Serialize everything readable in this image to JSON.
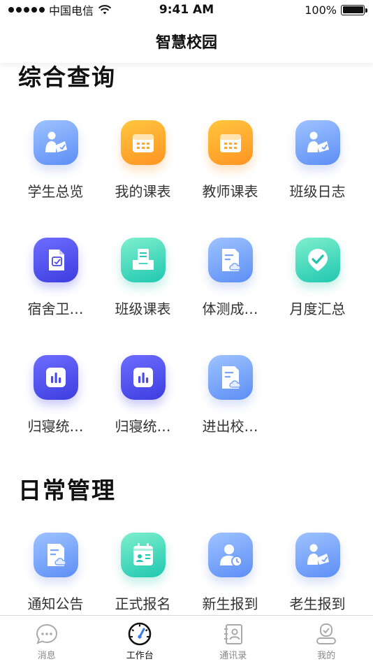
{
  "status_bar": {
    "carrier": "中国电信",
    "time": "9:41 AM",
    "battery": "100%"
  },
  "nav": {
    "title": "智慧校园"
  },
  "sections": [
    {
      "title": "综合查询",
      "items": [
        {
          "label": "学生总览",
          "icon": "student-reading-icon",
          "color": "blue"
        },
        {
          "label": "我的课表",
          "icon": "calendar-icon",
          "color": "orange"
        },
        {
          "label": "教师课表",
          "icon": "calendar-icon",
          "color": "orange"
        },
        {
          "label": "班级日志",
          "icon": "student-reading-icon",
          "color": "blue"
        },
        {
          "label": "宿舍卫…",
          "icon": "document-check-icon",
          "color": "indigo"
        },
        {
          "label": "班级课表",
          "icon": "tray-document-icon",
          "color": "teal"
        },
        {
          "label": "体测成…",
          "icon": "document-cloud-icon",
          "color": "blue"
        },
        {
          "label": "月度汇总",
          "icon": "check-badge-icon",
          "color": "teal"
        },
        {
          "label": "归寝统…",
          "icon": "bar-chart-icon",
          "color": "indigo"
        },
        {
          "label": "归寝统…",
          "icon": "bar-chart-icon",
          "color": "indigo"
        },
        {
          "label": "进出校…",
          "icon": "document-cloud-icon",
          "color": "blue"
        }
      ]
    },
    {
      "title": "日常管理",
      "items": [
        {
          "label": "通知公告",
          "icon": "document-cloud-icon",
          "color": "blue"
        },
        {
          "label": "正式报名",
          "icon": "id-card-calendar-icon",
          "color": "teal"
        },
        {
          "label": "新生报到",
          "icon": "person-clock-icon",
          "color": "blue"
        },
        {
          "label": "老生报到",
          "icon": "student-reading-icon",
          "color": "blue"
        }
      ]
    }
  ],
  "tab_bar": {
    "active": 1,
    "tabs": [
      {
        "label": "消息",
        "icon": "chat-bubble-icon"
      },
      {
        "label": "工作台",
        "icon": "speedometer-icon"
      },
      {
        "label": "通讯录",
        "icon": "contacts-icon"
      },
      {
        "label": "我的",
        "icon": "profile-icon"
      }
    ]
  }
}
